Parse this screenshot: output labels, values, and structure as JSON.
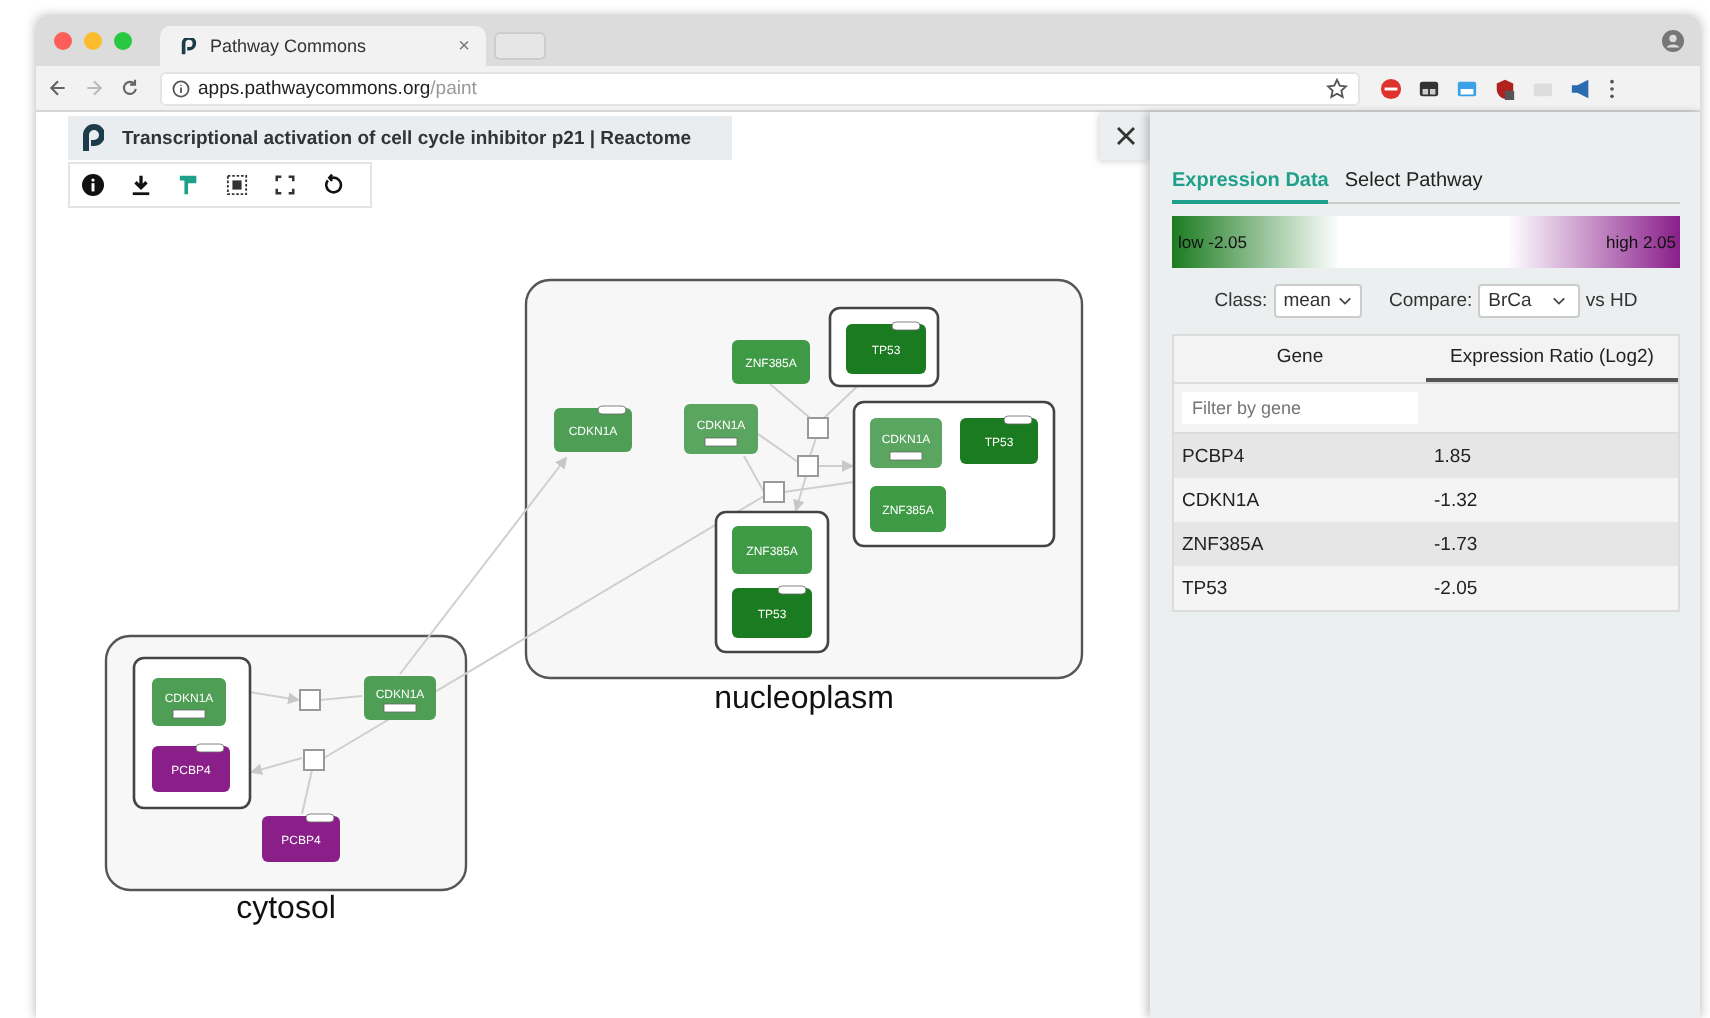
{
  "browser": {
    "tab_title": "Pathway Commons",
    "tab_close": "×",
    "url_host": "apps.pathwaycommons.org",
    "url_path": "/paint"
  },
  "pathway": {
    "title": "Transcriptional activation of cell cycle inhibitor p21 | Reactome"
  },
  "diagram": {
    "compartments": [
      {
        "label": "nucleoplasm"
      },
      {
        "label": "cytosol"
      }
    ],
    "nodes": [
      {
        "label": "ZNF385A",
        "color": "#3f9a45"
      },
      {
        "label": "TP53",
        "color": "#1b7b20"
      },
      {
        "label": "CDKN1A",
        "color": "#4f9e55"
      },
      {
        "label": "CDKN1A",
        "color": "#5aa55f"
      },
      {
        "label": "CDKN1A",
        "color": "#5aa55f"
      },
      {
        "label": "TP53",
        "color": "#1b7b20"
      },
      {
        "label": "ZNF385A",
        "color": "#3f9a45"
      },
      {
        "label": "ZNF385A",
        "color": "#3f9a45"
      },
      {
        "label": "TP53",
        "color": "#1b7b20"
      },
      {
        "label": "CDKN1A",
        "color": "#4f9e55"
      },
      {
        "label": "PCBP4",
        "color": "#8a1f8a"
      },
      {
        "label": "CDKN1A",
        "color": "#4f9e55"
      },
      {
        "label": "PCBP4",
        "color": "#8a1f8a"
      }
    ]
  },
  "panel": {
    "tabs": [
      {
        "label": "Expression Data",
        "selected": true
      },
      {
        "label": "Select Pathway",
        "selected": false
      }
    ],
    "legend": {
      "low": "low -2.05",
      "high": "high 2.05"
    },
    "class_label": "Class:",
    "class_value": "mean",
    "compare_label": "Compare:",
    "compare_value": "BrCa",
    "compare_suffix": "vs HD",
    "table": {
      "columns": [
        {
          "label": "Gene",
          "sorted": false
        },
        {
          "label": "Expression Ratio (Log2)",
          "sorted": true
        }
      ],
      "filter_placeholder": "Filter by gene",
      "rows": [
        {
          "gene": "PCBP4",
          "ratio": "1.85"
        },
        {
          "gene": "CDKN1A",
          "ratio": "-1.32"
        },
        {
          "gene": "ZNF385A",
          "ratio": "-1.73"
        },
        {
          "gene": "TP53",
          "ratio": "-2.05"
        }
      ]
    }
  }
}
